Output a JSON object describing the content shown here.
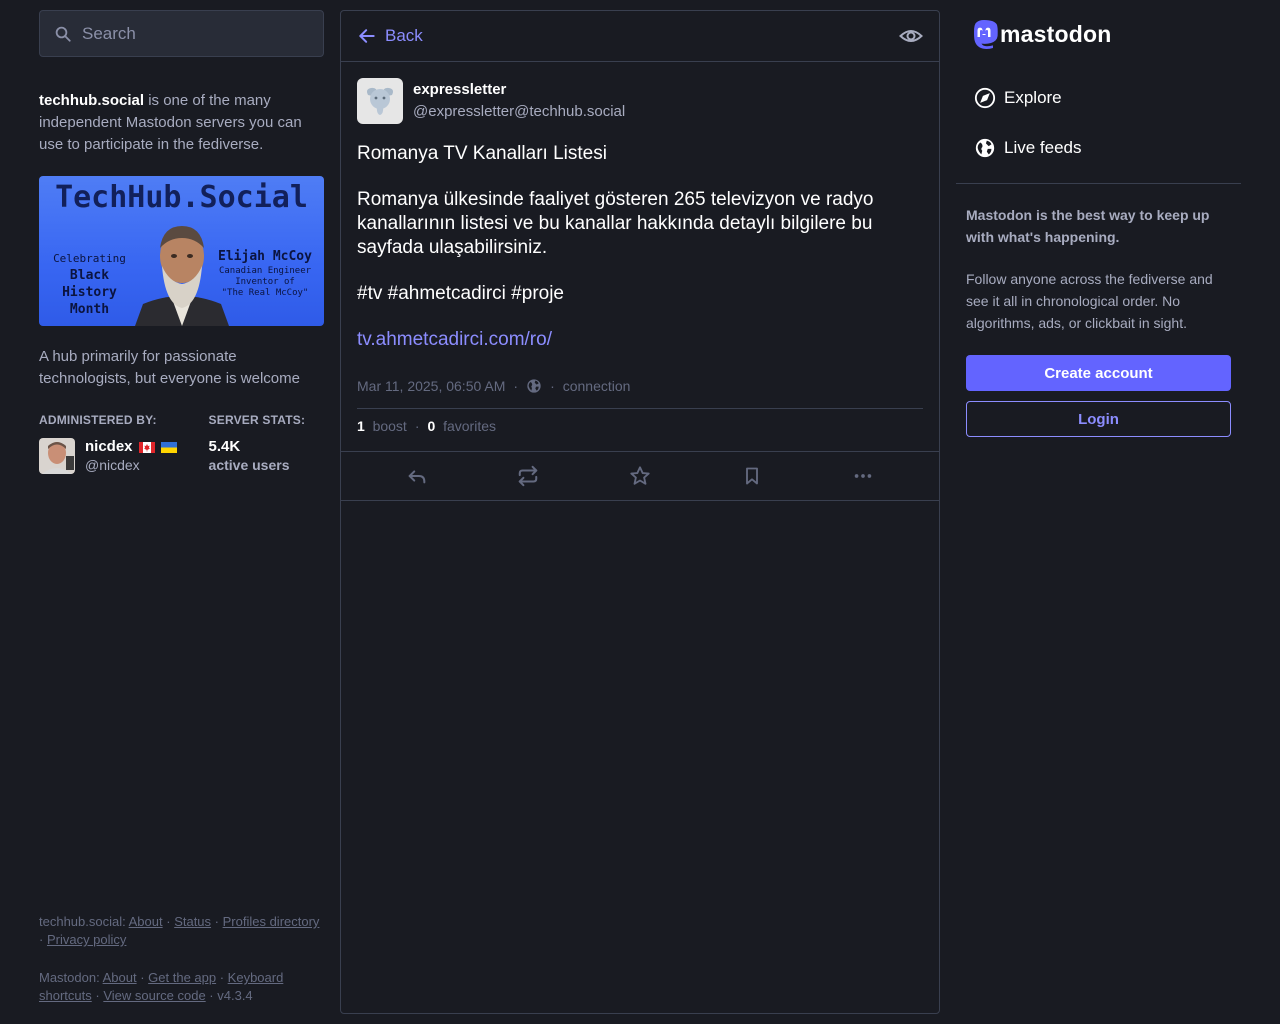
{
  "search": {
    "placeholder": "Search"
  },
  "server": {
    "domain": "techhub.social",
    "intro_rest": " is one of the many independent Mastodon servers you can use to participate in the fediverse.",
    "banner": {
      "title": "TechHub.Social",
      "left_line1": "Celebrating",
      "left_line2": "Black",
      "left_line3": "History",
      "left_line4": "Month",
      "right_name": "Elijah McCoy",
      "right_line1": "Canadian Engineer",
      "right_line2": "Inventor of",
      "right_line3": "\"The Real McCoy\""
    },
    "tagline": "A hub primarily for passionate technologists, but everyone is welcome",
    "administered_by_label": "ADMINISTERED BY:",
    "server_stats_label": "SERVER STATS:",
    "admin_name": "nicdex",
    "admin_handle": "@nicdex",
    "stat_value": "5.4K",
    "stat_label": "active users"
  },
  "footer": {
    "server_label": "techhub.social:",
    "server_links": [
      "About",
      "Status",
      "Profiles directory",
      "Privacy policy"
    ],
    "mastodon_label": "Mastodon:",
    "mastodon_links": [
      "About",
      "Get the app",
      "Keyboard shortcuts",
      "View source code"
    ],
    "version": "v4.3.4"
  },
  "column": {
    "back_label": "Back"
  },
  "status": {
    "display_name": "expressletter",
    "username": "@expressletter@techhub.social",
    "title": "Romanya TV Kanalları Listesi",
    "body": "Romanya ülkesinde faaliyet gösteren 265 televizyon ve radyo kanallarının listesi ve bu kanallar hakkında detaylı bilgilere bu sayfada ulaşabilirsiniz.",
    "hashtags": "#tv #ahmetcadirci #proje",
    "link": "tv.ahmetcadirci.com/ro/",
    "timestamp": "Mar 11, 2025, 06:50 AM",
    "app": "connection",
    "boost_count": "1",
    "boost_label": "boost",
    "fav_count": "0",
    "fav_label": "favorites"
  },
  "right": {
    "logo_text": "mastodon",
    "nav": [
      "Explore",
      "Live feeds"
    ],
    "promo_title": "Mastodon is the best way to keep up with what's happening.",
    "promo_body": "Follow anyone across the fediverse and see it all in chronological order. No algorithms, ads, or clickbait in sight.",
    "create_account": "Create account",
    "login": "Login"
  },
  "colors": {
    "background": "#191b22",
    "accent": "#6364ff",
    "link": "#8c8dff",
    "muted": "#a8acc0",
    "border": "#393f4f"
  },
  "icons": {
    "search": "search-icon",
    "back": "arrow-left-icon",
    "visibility": "eye-icon",
    "globe": "globe-icon",
    "reply": "reply-icon",
    "boost": "retweet-icon",
    "favourite": "star-icon",
    "bookmark": "bookmark-icon",
    "more": "ellipsis-icon",
    "explore": "compass-icon",
    "live": "globe-icon"
  }
}
